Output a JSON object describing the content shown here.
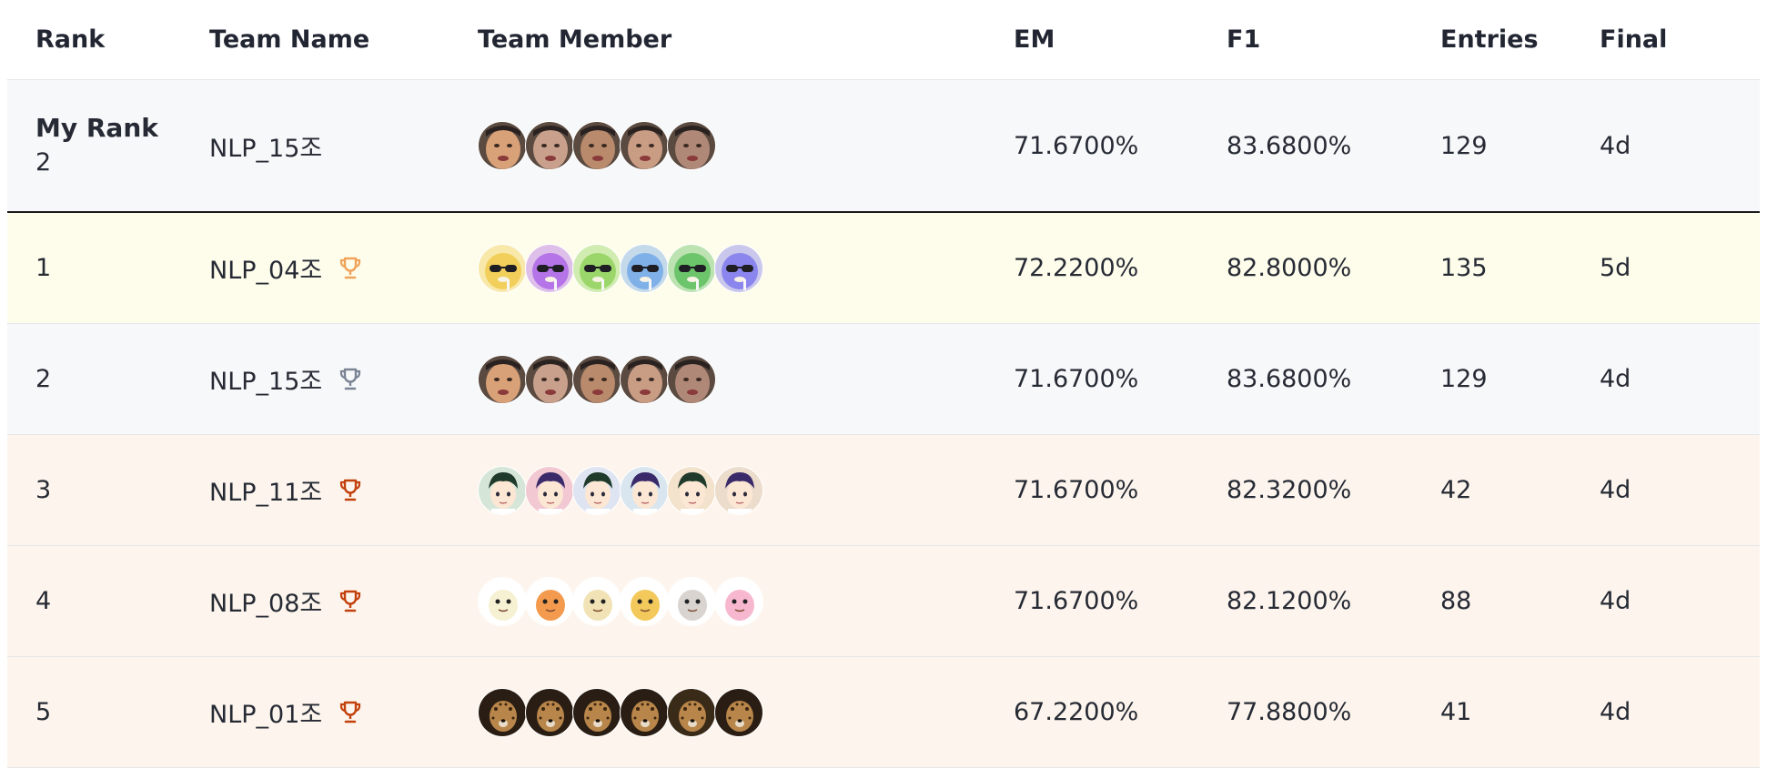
{
  "columns": {
    "rank": "Rank",
    "team_name": "Team Name",
    "team_member": "Team Member",
    "em": "EM",
    "f1": "F1",
    "entries": "Entries",
    "final": "Final"
  },
  "my_rank": {
    "label": "My Rank",
    "rank": "2",
    "team": "NLP_15조",
    "em": "71.6700%",
    "f1": "83.6800%",
    "entries": "129",
    "final": "4d",
    "avatar_style": "photo"
  },
  "rows": [
    {
      "rank": "1",
      "team": "NLP_04조",
      "trophy_icon": "trophy-icon",
      "trophy_color": "#f0a35a",
      "row_bg": "#fefdeb",
      "em": "72.2200%",
      "f1": "82.8000%",
      "entries": "135",
      "final": "5d",
      "avatar_style": "duck"
    },
    {
      "rank": "2",
      "team": "NLP_15조",
      "trophy_icon": "trophy-icon",
      "trophy_color": "#7b8494",
      "row_bg": "#f7f8fa",
      "em": "71.6700%",
      "f1": "83.6800%",
      "entries": "129",
      "final": "4d",
      "avatar_style": "photo"
    },
    {
      "rank": "3",
      "team": "NLP_11조",
      "trophy_icon": "trophy-icon",
      "trophy_color": "#c2410c",
      "row_bg": "#fdf5ed",
      "em": "71.6700%",
      "f1": "82.3200%",
      "entries": "42",
      "final": "4d",
      "avatar_style": "anime"
    },
    {
      "rank": "4",
      "team": "NLP_08조",
      "trophy_icon": "trophy-icon",
      "trophy_color": "#c2410c",
      "row_bg": "#fdf5ed",
      "em": "71.6700%",
      "f1": "82.1200%",
      "entries": "88",
      "final": "4d",
      "avatar_style": "pokemon"
    },
    {
      "rank": "5",
      "team": "NLP_01조",
      "trophy_icon": "trophy-icon",
      "trophy_color": "#c2410c",
      "row_bg": "#fdf5ed",
      "em": "67.2200%",
      "f1": "77.8800%",
      "entries": "41",
      "final": "4d",
      "avatar_style": "cheetah"
    }
  ],
  "avatar_palettes": {
    "photo": [
      "#d9a178",
      "#c9a08c",
      "#b98a6c",
      "#c99c84",
      "#b08878"
    ],
    "duck": [
      "#f2cf5b",
      "#b574e8",
      "#9bd66a",
      "#7fb0e8",
      "#6cc46b",
      "#8b86ee"
    ],
    "anime": [
      "#d5e6d8",
      "#f2c8d2",
      "#dfe4f2",
      "#d9e6f0",
      "#f3e2cc",
      "#ecdccc"
    ],
    "pokemon": [
      "#f6f1d2",
      "#f39a4e",
      "#f1e3b5",
      "#f2c95a",
      "#d9d4cf",
      "#f7b8cf"
    ],
    "cheetah": [
      "#2a1e14",
      "#2a1e14",
      "#2a1e14",
      "#2a1e14",
      "#3a2a18",
      "#2a1e14"
    ]
  }
}
